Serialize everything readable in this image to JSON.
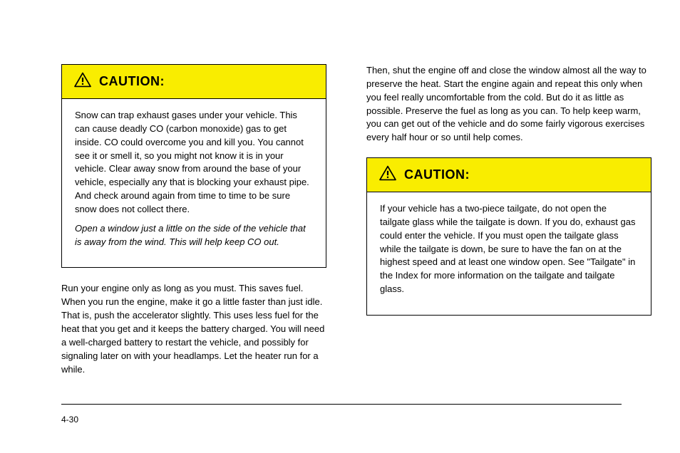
{
  "left": {
    "caution": {
      "title": "CAUTION:",
      "body": [
        "Snow can trap exhaust gases under your vehicle. This can cause deadly CO (carbon monoxide) gas to get inside. CO could overcome you and kill you. You cannot see it or smell it, so you might not know it is in your vehicle. Clear away snow from around the base of your vehicle, especially any that is blocking your exhaust pipe. And check around again from time to time to be sure snow does not collect there.",
        "Open a window just a little on the side of the vehicle that is away from the wind. This will help keep CO out."
      ]
    },
    "para1_prefix": "Run your engine only as long as you must. This saves fuel. When you run the engine, make it go a little faster than just idle. That is, push the accelerator slightly. This uses less fuel for the heat that you get and it keeps the battery charged. You will need a well-charged battery to restart the vehicle, and possibly for signaling later on with your headlamps. Let the heater run for a while."
  },
  "right": {
    "upper": "Then, shut the engine off and close the window almost all the way to preserve the heat. Start the engine again and repeat this only when you feel really uncomfortable from the cold. But do it as little as possible. Preserve the fuel as long as you can. To help keep warm, you can get out of the vehicle and do some fairly vigorous exercises every half hour or so until help comes.",
    "caution": {
      "title": "CAUTION:",
      "body": [
        "If your vehicle has a two-piece tailgate, do not open the tailgate glass while the tailgate is down. If you do, exhaust gas could enter the vehicle. If you must open the tailgate glass while the tailgate is down, be sure to have the fan on at the highest speed and at least one window open. See \"Tailgate\" in the Index for more information on the tailgate and tailgate glass."
      ]
    }
  },
  "footer": {
    "pageNumber": "4-30"
  }
}
